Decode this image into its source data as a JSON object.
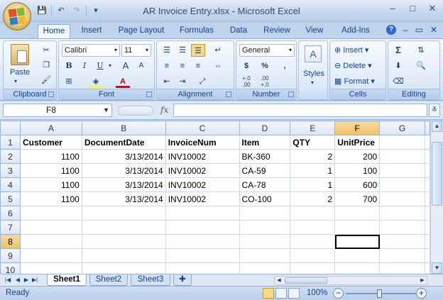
{
  "window": {
    "title": "AR Invoice Entry.xlsx - Microsoft Excel",
    "controls": {
      "minimize": "–",
      "maximize": "□",
      "close": "✕"
    }
  },
  "quick_access": {
    "save": "💾",
    "undo": "↶",
    "redo": "↷",
    "customize": "▾"
  },
  "ribbon_tabs": [
    {
      "label": "Home",
      "active": true
    },
    {
      "label": "Insert"
    },
    {
      "label": "Page Layout"
    },
    {
      "label": "Formulas"
    },
    {
      "label": "Data"
    },
    {
      "label": "Review"
    },
    {
      "label": "View"
    },
    {
      "label": "Add-Ins"
    }
  ],
  "ribbon_help": {
    "help": "?",
    "min": "–",
    "restore": "▭",
    "close": "✕"
  },
  "ribbon": {
    "clipboard": {
      "label": "Clipboard",
      "paste": "Paste"
    },
    "font": {
      "label": "Font",
      "family": "Calibri",
      "size": "11",
      "bold": "B",
      "italic": "I",
      "underline": "U",
      "grow": "A",
      "shrink": "A",
      "font_color": "A"
    },
    "alignment": {
      "label": "Alignment"
    },
    "number": {
      "label": "Number",
      "format": "General",
      "currency": "$",
      "percent": "%",
      "comma": ",",
      "inc_decimal": "+.0\n.00",
      "dec_decimal": ".00\n+.0"
    },
    "styles": {
      "label": "Styles"
    },
    "cells": {
      "label": "Cells",
      "insert": "Insert",
      "delete": "Delete",
      "format": "Format"
    },
    "editing": {
      "label": "Editing"
    }
  },
  "formula_bar": {
    "name_box": "F8",
    "fx": "fx",
    "content": ""
  },
  "columns": [
    "A",
    "B",
    "C",
    "D",
    "E",
    "F",
    "G"
  ],
  "selected_column": "F",
  "selected_row": 8,
  "rows": [
    {
      "n": "1",
      "cells": [
        "Customer",
        "DocumentDate",
        "InvoiceNum",
        "Item",
        "QTY",
        "UnitPrice",
        ""
      ]
    },
    {
      "n": "2",
      "cells": [
        "1100",
        "3/13/2014",
        "INV10002",
        "BK-360",
        "2",
        "200",
        ""
      ]
    },
    {
      "n": "3",
      "cells": [
        "1100",
        "3/13/2014",
        "INV10002",
        "CA-59",
        "1",
        "100",
        ""
      ]
    },
    {
      "n": "4",
      "cells": [
        "1100",
        "3/13/2014",
        "INV10002",
        "CA-78",
        "1",
        "600",
        ""
      ]
    },
    {
      "n": "5",
      "cells": [
        "1100",
        "3/13/2014",
        "INV10002",
        "CO-100",
        "2",
        "700",
        ""
      ]
    },
    {
      "n": "6",
      "cells": [
        "",
        "",
        "",
        "",
        "",
        "",
        ""
      ]
    },
    {
      "n": "7",
      "cells": [
        "",
        "",
        "",
        "",
        "",
        "",
        ""
      ]
    },
    {
      "n": "8",
      "cells": [
        "",
        "",
        "",
        "",
        "",
        "",
        ""
      ]
    },
    {
      "n": "9",
      "cells": [
        "",
        "",
        "",
        "",
        "",
        "",
        ""
      ]
    },
    {
      "n": "10",
      "cells": [
        "",
        "",
        "",
        "",
        "",
        "",
        ""
      ]
    }
  ],
  "sheet_tabs": [
    {
      "label": "Sheet1",
      "active": true
    },
    {
      "label": "Sheet2"
    },
    {
      "label": "Sheet3"
    }
  ],
  "status": {
    "text": "Ready",
    "zoom": "100%",
    "zoom_minus": "−",
    "zoom_plus": "+"
  }
}
